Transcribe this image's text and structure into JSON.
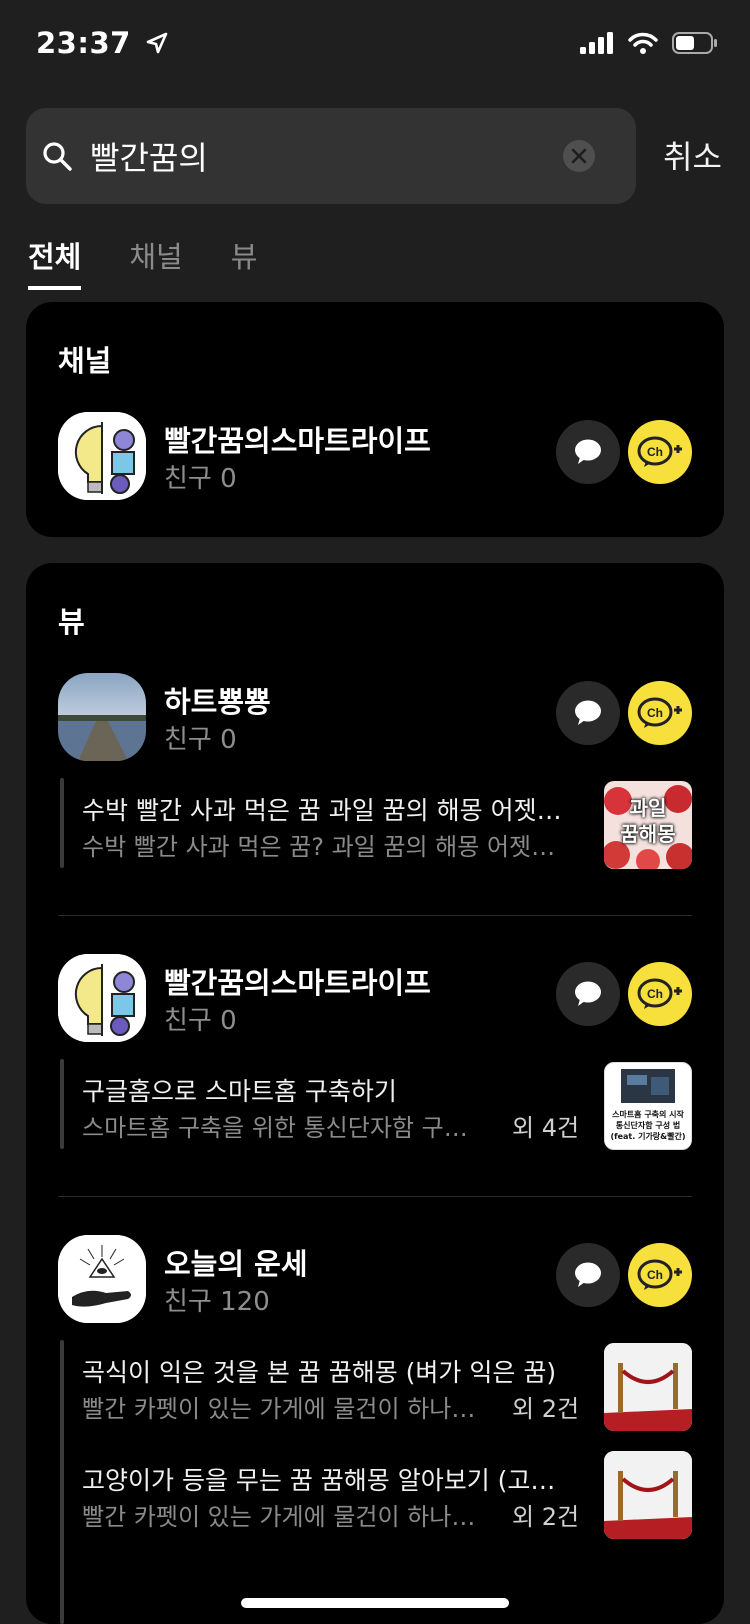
{
  "status_bar": {
    "time": "23:37"
  },
  "search": {
    "value": "빨간꿈의",
    "cancel_label": "취소"
  },
  "tabs": [
    {
      "label": "전체",
      "active": true
    },
    {
      "label": "채널",
      "active": false
    },
    {
      "label": "뷰",
      "active": false
    }
  ],
  "channel_section": {
    "title": "채널",
    "item": {
      "name": "빨간꿈의스마트라이프",
      "friends": "친구 0"
    }
  },
  "view_section": {
    "title": "뷰",
    "items": [
      {
        "name": "하트뿅뿅",
        "friends": "친구 0",
        "posts": [
          {
            "title": "수박 빨간 사과 먹은 꿈 과일 꿈의 해몽 어젯…",
            "desc": "수박 빨간 사과 먹은 꿈? 과일 꿈의 해몽 어젯…",
            "extra": "",
            "thumb_text": [
              "과일",
              "꿈해몽"
            ]
          }
        ]
      },
      {
        "name": "빨간꿈의스마트라이프",
        "friends": "친구 0",
        "posts": [
          {
            "title": "구글홈으로 스마트홈 구축하기",
            "desc": "스마트홈 구축을 위한 통신단자함 구성…",
            "extra": "외 4건",
            "thumb_text": [
              "스마트홈 구축의 시작",
              "통신단자함 구성 법",
              "(feat. 기가랑&빨간)"
            ]
          }
        ]
      },
      {
        "name": "오늘의 운세",
        "friends": "친구 120",
        "posts": [
          {
            "title": "곡식이 익은 것을 본 꿈 꿈해몽 (벼가 익은 꿈)",
            "desc": "빨간 카펫이 있는 가게에 물건이 하나도…",
            "extra": "외 2건"
          },
          {
            "title": "고양이가 등을 무는 꿈 꿈해몽 알아보기 (고…",
            "desc": "빨간 카펫이 있는 가게에 물건이 하나도…",
            "extra": "외 2건"
          }
        ]
      }
    ]
  },
  "colors": {
    "accent_yellow": "#f7e03c",
    "background": "#1f1f1f",
    "card": "#000000"
  }
}
